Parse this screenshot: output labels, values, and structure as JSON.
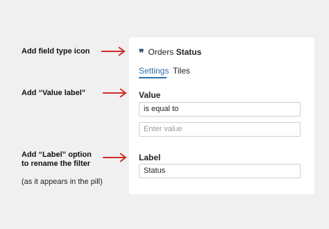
{
  "annotations": {
    "icon": "Add field type icon",
    "value_label": "Add “Value label”",
    "label_option_line1": "Add “Label” option",
    "label_option_line2": "to rename the filter",
    "label_option_note": "(as it appears in the pill)"
  },
  "panel": {
    "icon": "quote-icon",
    "title_prefix": "Orders",
    "title_field": "Status",
    "tabs": [
      {
        "label": "Settings",
        "active": true
      },
      {
        "label": "Tiles",
        "active": false
      }
    ],
    "value": {
      "label": "Value",
      "operator": "is equal to",
      "placeholder": "Enter value"
    },
    "label_field": {
      "label": "Label",
      "value": "Status"
    }
  },
  "colors": {
    "arrow": "#d22b2b",
    "accent": "#2f6fab",
    "background": "#f0f0f0"
  }
}
